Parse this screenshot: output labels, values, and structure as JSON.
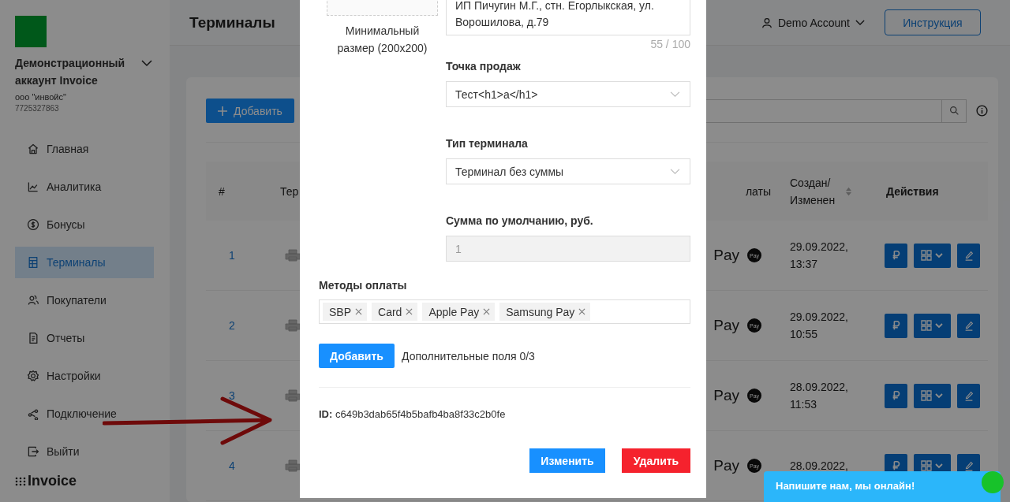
{
  "sidebar": {
    "account_name": "Демонстрационный аккаунт Invoice",
    "company": "ооо \"инвойс\"",
    "inn": "7725327863",
    "items": [
      {
        "label": "Главная",
        "selected": false
      },
      {
        "label": "Аналитика",
        "selected": false
      },
      {
        "label": "Бонусы",
        "selected": false
      },
      {
        "label": "Терминалы",
        "selected": true
      },
      {
        "label": "Покупатели",
        "selected": false
      },
      {
        "label": "Отчеты",
        "selected": false
      },
      {
        "label": "Настройки",
        "selected": false
      },
      {
        "label": "Подключение",
        "selected": false
      },
      {
        "label": "Выйти",
        "selected": false
      }
    ],
    "brand": "Invoice"
  },
  "header": {
    "title": "Терминалы",
    "user": "Demo Account",
    "help_button": "Инструкция"
  },
  "toolbar": {
    "add_button": "Добавить"
  },
  "table": {
    "columns": [
      "#",
      "Тер",
      "латы",
      "Создан/ Изменен",
      "Действия"
    ],
    "rows": [
      {
        "number": "1",
        "payment": "Pay",
        "badge": "Pay",
        "created": [
          "29.09.2022,",
          "13:37"
        ]
      },
      {
        "number": "2",
        "payment": "Pay",
        "badge": "Pay",
        "created": [
          "29.09.2022,",
          "10:55"
        ]
      },
      {
        "number": "3",
        "payment": "Pay",
        "badge": "Pay",
        "created": [
          "28.09.2022,",
          "11:53"
        ]
      },
      {
        "number": "4",
        "payment": "Pay",
        "badge": "Pay",
        "created": [
          "28.09.2022,"
        ]
      }
    ]
  },
  "modal": {
    "upload_hint": "Минимальный размер (200x200)",
    "address": "ИП Пичугин М.Г., стн. Егорлыкская, ул. Ворошилова, д.79",
    "counter": "55 / 100",
    "fields": [
      {
        "kind": "select",
        "label": "Точка продаж",
        "value": "Тест<h1>a</h1>",
        "disabled": false
      },
      {
        "kind": "select",
        "label": "Тип терминала",
        "value": "Терминал без суммы",
        "disabled": false
      },
      {
        "kind": "input",
        "label": "Сумма по умолчанию, руб.",
        "value": "1",
        "disabled": true
      }
    ],
    "payment_methods": {
      "label": "Методы оплаты",
      "tags": [
        "SBP",
        "Card",
        "Apple Pay",
        "Samsung Pay"
      ]
    },
    "add_button": "Добавить",
    "extra_fields": "Дополнительные поля 0/3",
    "id_label": "ID:",
    "id_value": "c649b3dab65f4b5bafb4ba8f33c2b0fe",
    "save_button": "Изменить",
    "delete_button": "Удалить"
  },
  "chat": {
    "text": "Напишите нам, мы онлайн!"
  }
}
